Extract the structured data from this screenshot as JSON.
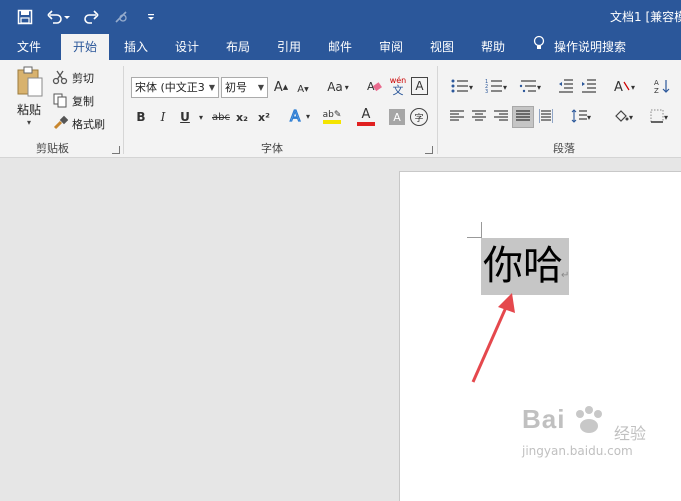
{
  "window": {
    "title": "文档1 [兼容模"
  },
  "qat": {
    "save_icon": "save-icon",
    "undo_icon": "undo-icon",
    "redo_icon": "redo-icon",
    "touch_icon": "touch-mode-icon",
    "customize_icon": "chevron-down-icon"
  },
  "tabs": [
    {
      "label": "文件"
    },
    {
      "label": "开始"
    },
    {
      "label": "插入"
    },
    {
      "label": "设计"
    },
    {
      "label": "布局"
    },
    {
      "label": "引用"
    },
    {
      "label": "邮件"
    },
    {
      "label": "审阅"
    },
    {
      "label": "视图"
    },
    {
      "label": "帮助"
    }
  ],
  "tellme": {
    "label": "操作说明搜索"
  },
  "clipboard": {
    "group_label": "剪贴板",
    "paste_label": "粘贴",
    "cut_label": "剪切",
    "copy_label": "复制",
    "format_painter_label": "格式刷"
  },
  "font": {
    "group_label": "字体",
    "font_name": "宋体 (中文正3",
    "font_size": "初号",
    "case_label": "Aa",
    "bold": "B",
    "italic": "I",
    "underline": "U",
    "strike": "abc",
    "subscript": "x₂",
    "superscript": "x²",
    "pinyin": "wén",
    "border_char": "A",
    "shade_char": "A",
    "enclose_char": "字"
  },
  "paragraph": {
    "group_label": "段落"
  },
  "document": {
    "text": "你哈",
    "para_mark": "↵"
  },
  "watermark": {
    "main": "Bai",
    "cn": "经验",
    "sub": "jingyan.baidu.com"
  },
  "colors": {
    "accent": "#2b579a",
    "highlight": "#c6c6c6",
    "font_red": "#e02020",
    "highlight_yellow": "#f4e400",
    "arrow": "#e5484d"
  }
}
